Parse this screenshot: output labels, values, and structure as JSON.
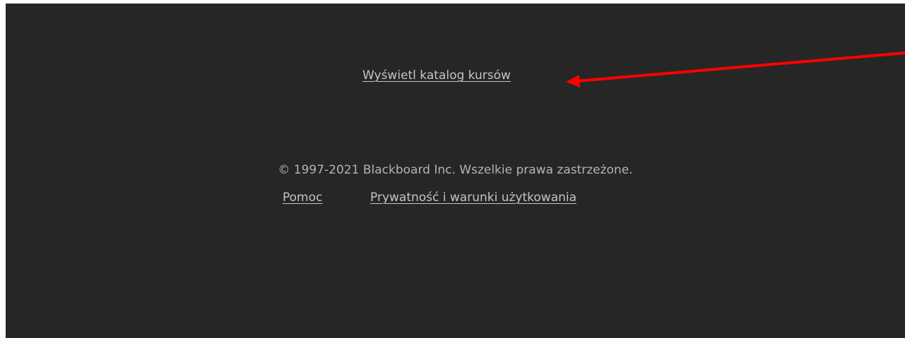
{
  "footer": {
    "catalog_link": "Wyświetl katalog kursów",
    "copyright": "© 1997-2021 Blackboard Inc. Wszelkie prawa zastrzeżone.",
    "help_link": "Pomoc",
    "privacy_link": "Prywatność i warunki użytkowania"
  },
  "colors": {
    "background": "#262626",
    "link_text": "#c4c4c4",
    "annotation_arrow": "#ff0000"
  },
  "icons": {
    "annotation": "red-arrow-icon"
  }
}
